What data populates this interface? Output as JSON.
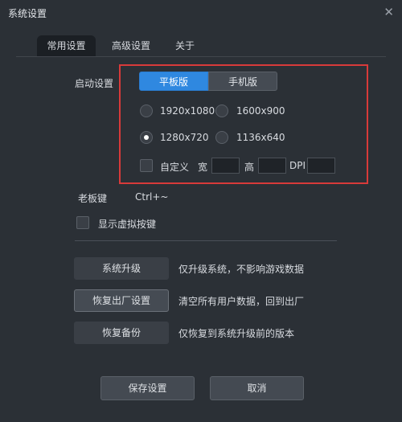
{
  "window": {
    "title": "系统设置",
    "close_icon": "close-icon"
  },
  "tabs": [
    {
      "label": "常用设置",
      "active": true
    },
    {
      "label": "高级设置",
      "active": false
    },
    {
      "label": "关于",
      "active": false
    }
  ],
  "startup": {
    "label": "启动设置",
    "modes": [
      {
        "label": "平板版",
        "selected": true
      },
      {
        "label": "手机版",
        "selected": false
      }
    ],
    "resolutions": [
      {
        "label": "1920x1080",
        "selected": false
      },
      {
        "label": "1600x900",
        "selected": false
      },
      {
        "label": "1280x720",
        "selected": true
      },
      {
        "label": "1136x640",
        "selected": false
      }
    ],
    "custom": {
      "label": "自定义",
      "checked": false,
      "width_label": "宽",
      "width_value": "",
      "height_label": "高",
      "height_value": "",
      "dpi_label": "DPI",
      "dpi_value": ""
    }
  },
  "boss_key": {
    "label": "老板键",
    "value": "Ctrl+~"
  },
  "virtual_keys": {
    "label": "显示虚拟按键",
    "checked": false
  },
  "actions": [
    {
      "button": "系统升级",
      "description": "仅升级系统，不影响游戏数据"
    },
    {
      "button": "恢复出厂设置",
      "description": "清空所有用户数据，回到出厂"
    },
    {
      "button": "恢复备份",
      "description": "仅恢复到系统升级前的版本"
    }
  ],
  "footer": {
    "save_label": "保存设置",
    "cancel_label": "取消"
  },
  "colors": {
    "background": "#2b3036",
    "accent": "#2f88e0",
    "highlight_border": "#d83a3a"
  }
}
